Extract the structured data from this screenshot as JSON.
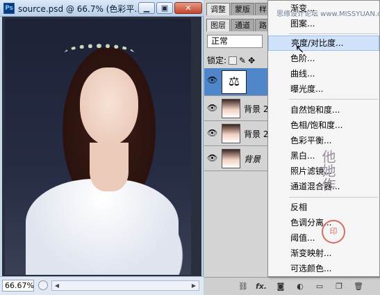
{
  "document": {
    "title": "source.psd @ 66.7% (色彩平...",
    "app_icon": "Ps",
    "zoom_value": "66.67%",
    "window_buttons": {
      "minimize": "▁",
      "restore": "▣",
      "close": "✕"
    }
  },
  "panel": {
    "tabs_top": [
      "调整",
      "蒙版",
      "样"
    ],
    "tabs_layers": [
      "图层",
      "通道",
      "路"
    ],
    "blend_mode": "正常",
    "lock_label": "锁定:",
    "layers": [
      {
        "name": "",
        "type": "adjustment",
        "selected": true
      },
      {
        "name": "背景 2",
        "type": "image"
      },
      {
        "name": "背景 2",
        "type": "image"
      },
      {
        "name": "背景",
        "type": "image"
      }
    ],
    "bottom_icons": [
      "link-icon",
      "fx-icon",
      "mask-icon",
      "adjustment-icon",
      "folder-icon",
      "new-layer-icon",
      "trash-icon"
    ],
    "fx_label": "fx."
  },
  "menu": {
    "items": [
      {
        "label": "渐变..."
      },
      {
        "label": "图案..."
      },
      {
        "label": "亮度/对比度...",
        "hover": true
      },
      {
        "label": "色阶..."
      },
      {
        "label": "曲线..."
      },
      {
        "label": "曝光度..."
      },
      {
        "label": "自然饱和度..."
      },
      {
        "label": "色相/饱和度..."
      },
      {
        "label": "色彩平衡..."
      },
      {
        "label": "黑白..."
      },
      {
        "label": "照片滤镜..."
      },
      {
        "label": "通道混合器..."
      },
      {
        "label": "反相"
      },
      {
        "label": "色调分离..."
      },
      {
        "label": "阈值..."
      },
      {
        "label": "渐变映射..."
      },
      {
        "label": "可选颜色..."
      }
    ]
  },
  "watermarks": {
    "top": "思缘设计论坛 www.MISSYUAN.com",
    "vertical": "他她作"
  }
}
